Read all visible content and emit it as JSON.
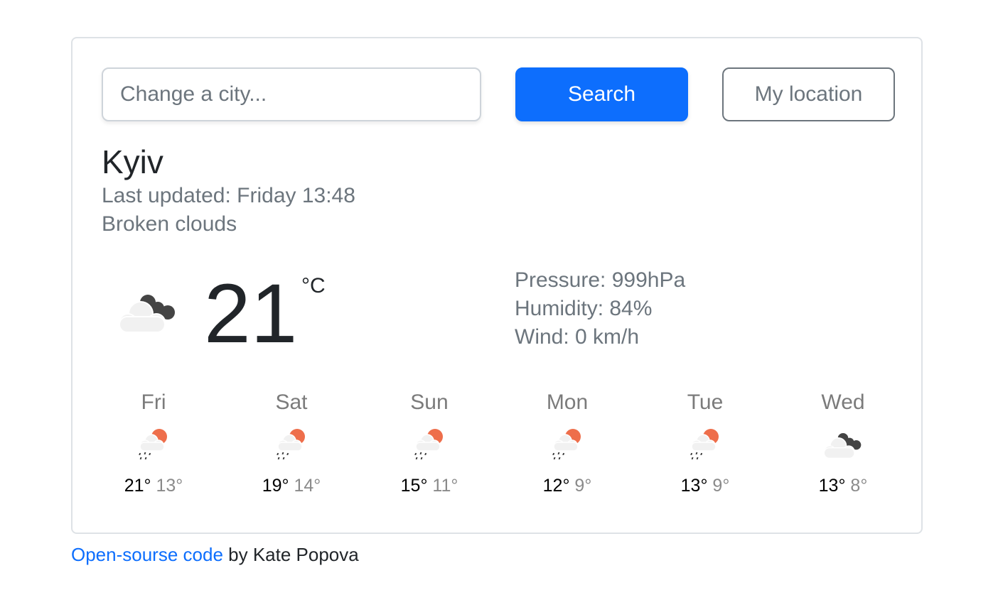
{
  "search": {
    "placeholder": "Change a city...",
    "value": "",
    "search_label": "Search",
    "location_label": "My location"
  },
  "current": {
    "city": "Kyiv",
    "last_updated": "Last updated: Friday 13:48",
    "description": "Broken clouds",
    "icon": "broken-clouds-icon",
    "temperature": "21",
    "unit": "°C",
    "pressure": "Pressure: 999hPa",
    "humidity": "Humidity: 84%",
    "wind": "Wind: 0 km/h"
  },
  "forecast": [
    {
      "day": "Fri",
      "icon": "rain-sun-icon",
      "max": "21°",
      "min": "13°"
    },
    {
      "day": "Sat",
      "icon": "rain-sun-icon",
      "max": "19°",
      "min": "14°"
    },
    {
      "day": "Sun",
      "icon": "rain-sun-icon",
      "max": "15°",
      "min": "11°"
    },
    {
      "day": "Mon",
      "icon": "rain-sun-icon",
      "max": "12°",
      "min": "9°"
    },
    {
      "day": "Tue",
      "icon": "rain-sun-icon",
      "max": "13°",
      "min": "9°"
    },
    {
      "day": "Wed",
      "icon": "broken-clouds-icon",
      "max": "13°",
      "min": "8°"
    }
  ],
  "colors": {
    "primary": "#0d6efd",
    "sun": "#ee6e4b",
    "cloud_light": "#f1f1f1",
    "cloud_dark": "#444444"
  },
  "footer": {
    "link_label": "Open-sourse code",
    "credit": " by Kate Popova"
  }
}
